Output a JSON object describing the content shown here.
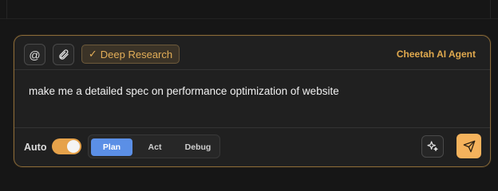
{
  "toolbar": {
    "mention_icon": "@",
    "deep_research": {
      "check_icon": "✓",
      "label": "Deep Research"
    },
    "agent_name": "Cheetah AI Agent"
  },
  "prompt": {
    "text": "make me a detailed spec on performance optimization of website"
  },
  "footer": {
    "auto_label": "Auto",
    "auto_enabled": true,
    "modes": [
      "Plan",
      "Act",
      "Debug"
    ],
    "active_mode": "Plan"
  },
  "colors": {
    "accent": "#e0a94e",
    "send_button": "#f4b25c",
    "active_mode": "#5b8fe6",
    "border": "#8a6a38"
  },
  "icons": {
    "mention": "at-icon",
    "attach": "paperclip-icon",
    "enhance": "sparkle-icon",
    "send": "send-icon"
  }
}
